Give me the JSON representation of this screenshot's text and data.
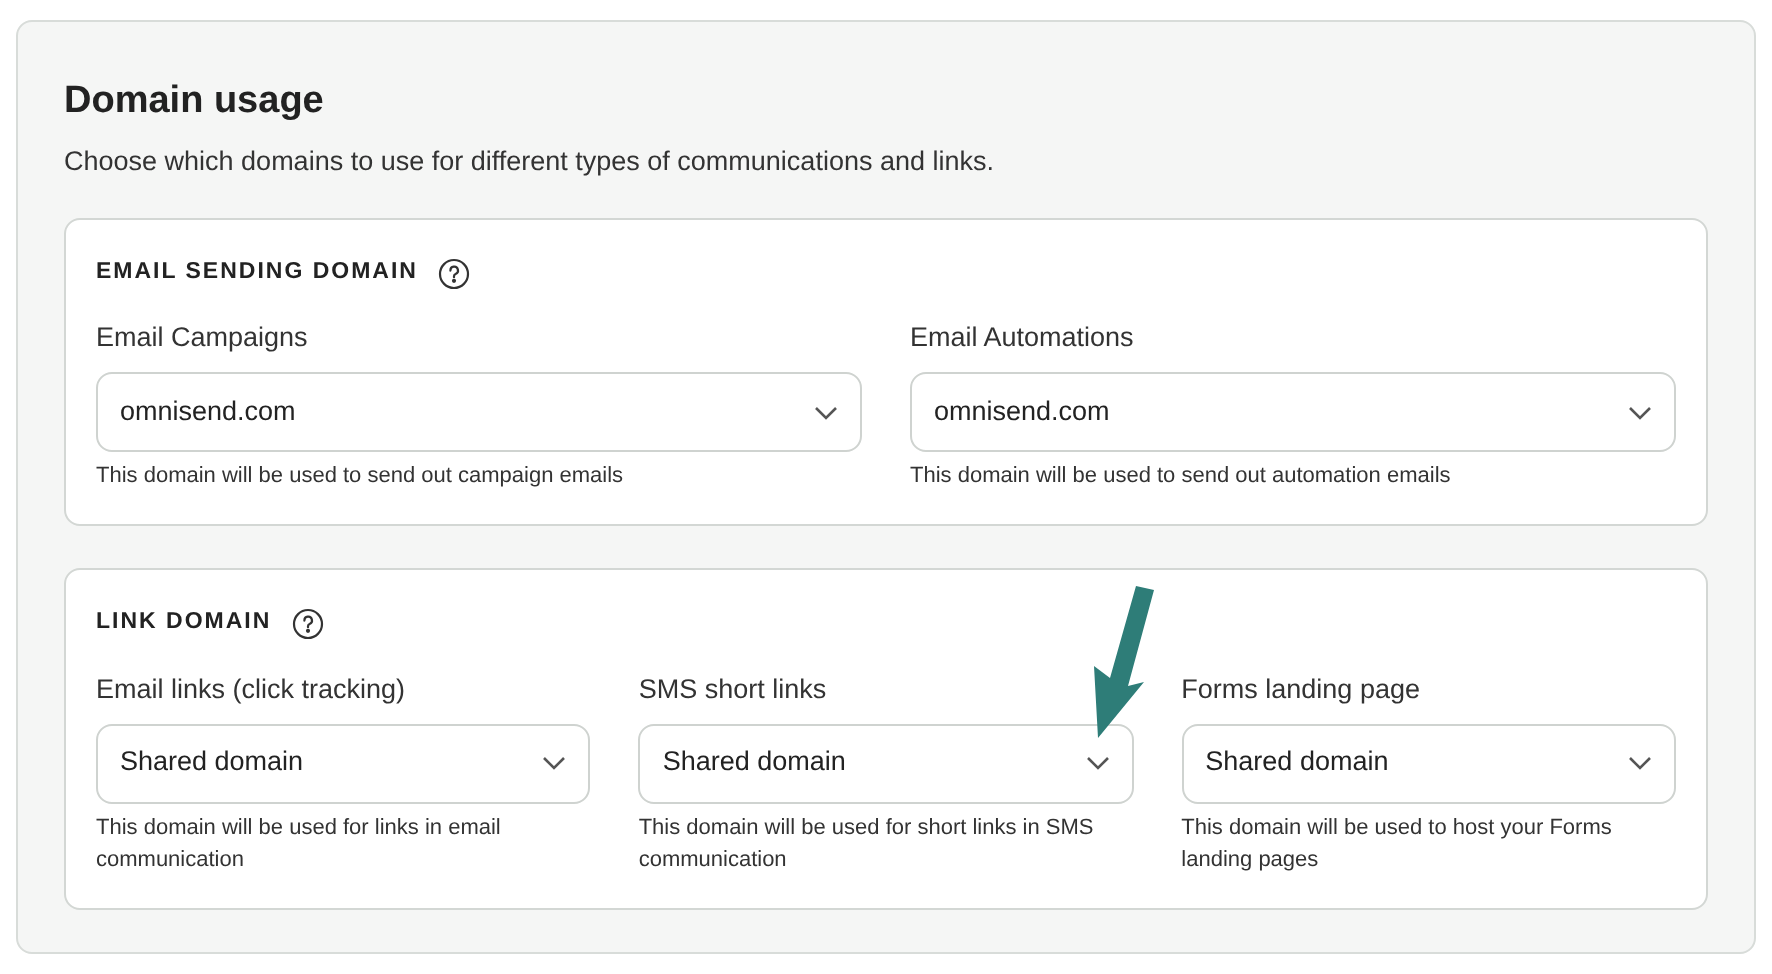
{
  "title": "Domain usage",
  "subtitle": "Choose which domains to use for different types of communications and links.",
  "sections": [
    {
      "heading": "EMAIL SENDING DOMAIN",
      "fields": [
        {
          "label": "Email Campaigns",
          "value": "omnisend.com",
          "hint": "This domain will be used to send out campaign emails"
        },
        {
          "label": "Email Automations",
          "value": "omnisend.com",
          "hint": "This domain will be used to send out automation emails"
        }
      ]
    },
    {
      "heading": "LINK DOMAIN",
      "fields": [
        {
          "label": "Email links (click tracking)",
          "value": "Shared domain",
          "hint": "This domain will be used for links in email communication"
        },
        {
          "label": "SMS short links",
          "value": "Shared domain",
          "hint": "This domain will be used for short links in SMS communication"
        },
        {
          "label": "Forms landing page",
          "value": "Shared domain",
          "hint": "This domain will be used to host your Forms landing pages"
        }
      ]
    }
  ]
}
